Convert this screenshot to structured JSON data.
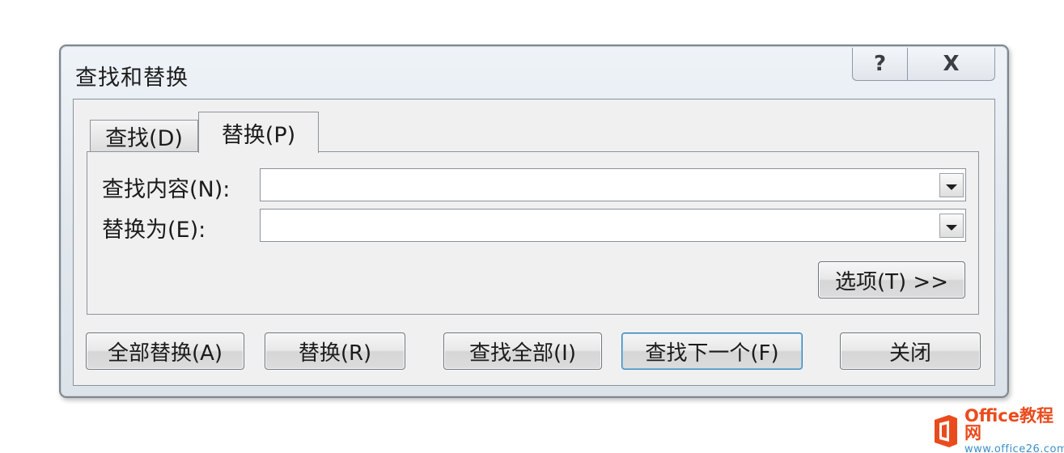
{
  "window": {
    "title": "查找和替换",
    "help_glyph": "?",
    "close_glyph": "X"
  },
  "tabs": [
    {
      "label": "查找(D)",
      "active": false
    },
    {
      "label": "替换(P)",
      "active": true
    }
  ],
  "find_field": {
    "label": "查找内容(N):",
    "value": ""
  },
  "replace_field": {
    "label": "替换为(E):",
    "value": ""
  },
  "buttons": {
    "options": "选项(T) >>",
    "replace_all": "全部替换(A)",
    "replace": "替换(R)",
    "find_all": "查找全部(I)",
    "find_next": "查找下一个(F)",
    "close": "关闭"
  },
  "watermark": {
    "line1": "Office教程网",
    "line2": "www.office26.com",
    "logo_color": "#ea4b1d"
  }
}
